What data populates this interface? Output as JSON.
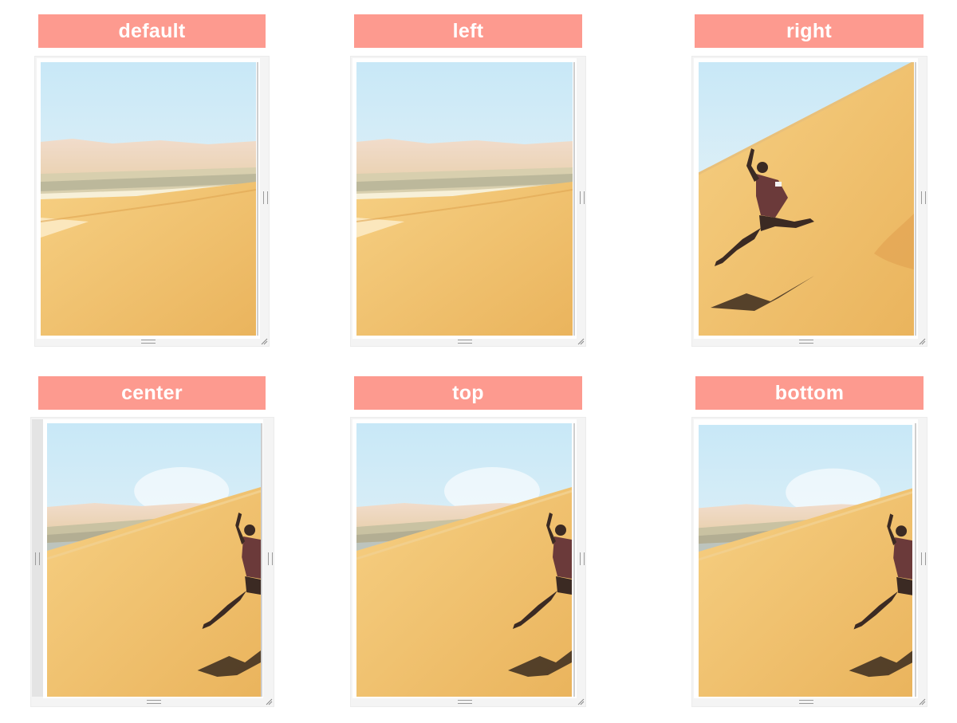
{
  "panels": [
    {
      "id": "default",
      "label": "default",
      "scene": "dunes"
    },
    {
      "id": "left",
      "label": "left",
      "scene": "dunes"
    },
    {
      "id": "right",
      "label": "right",
      "scene": "jumper-full"
    },
    {
      "id": "center",
      "label": "center",
      "scene": "jumper-edge"
    },
    {
      "id": "top",
      "label": "top",
      "scene": "jumper-edge"
    },
    {
      "id": "bottom",
      "label": "bottom",
      "scene": "jumper-edge"
    }
  ],
  "colors": {
    "label_bg": "#fd9a8f",
    "label_text": "#ffffff",
    "sand": "#f0c26a",
    "sky": "#cfe9f6"
  },
  "icons": {
    "vertical_handle": "resize-handle-vertical-icon",
    "horizontal_handle": "resize-handle-horizontal-icon",
    "corner_grip": "resize-corner-grip-icon"
  }
}
